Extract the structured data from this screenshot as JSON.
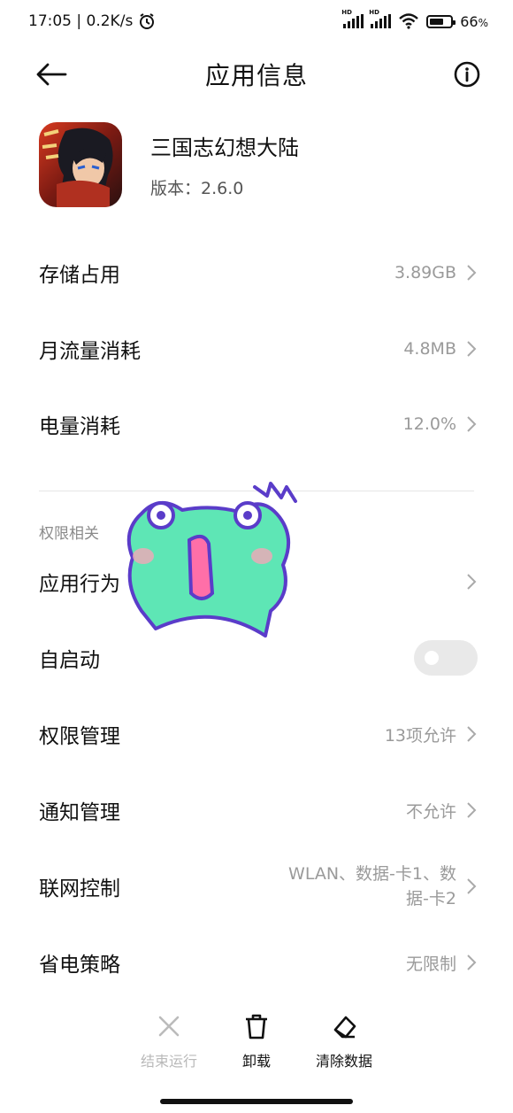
{
  "status_bar": {
    "time_speed": "17:05 | 0.2K/s",
    "battery": "66",
    "battery_unit": "%",
    "battery_level": 0.66,
    "signal_label": "HD"
  },
  "header": {
    "title": "应用信息"
  },
  "app": {
    "name": "三国志幻想大陆",
    "version": "版本：2.6.0"
  },
  "rows_top": [
    {
      "label": "存储占用",
      "value": "3.89GB"
    },
    {
      "label": "月流量消耗",
      "value": "4.8MB"
    },
    {
      "label": "电量消耗",
      "value": "12.0%"
    }
  ],
  "permissions": {
    "section_title": "权限相关",
    "behavior_label": "应用行为",
    "autostart_label": "自启动",
    "autostart_enabled": false,
    "items": [
      {
        "label": "权限管理",
        "value": "13项允许"
      },
      {
        "label": "通知管理",
        "value": "不允许"
      },
      {
        "label": "联网控制",
        "value_line1": "WLAN、数据-卡1、数",
        "value_line2": "据-卡2"
      },
      {
        "label": "省电策略",
        "value": "无限制"
      }
    ]
  },
  "actions": {
    "end": "结束运行",
    "uninstall": "卸载",
    "clear": "清除数据"
  },
  "colors": {
    "text_primary": "#111111",
    "text_secondary": "#9a9a9a",
    "toggle_off": "#e9e9e9",
    "sticker_green": "#5ee6b5",
    "sticker_outline": "#5a3cc9"
  }
}
